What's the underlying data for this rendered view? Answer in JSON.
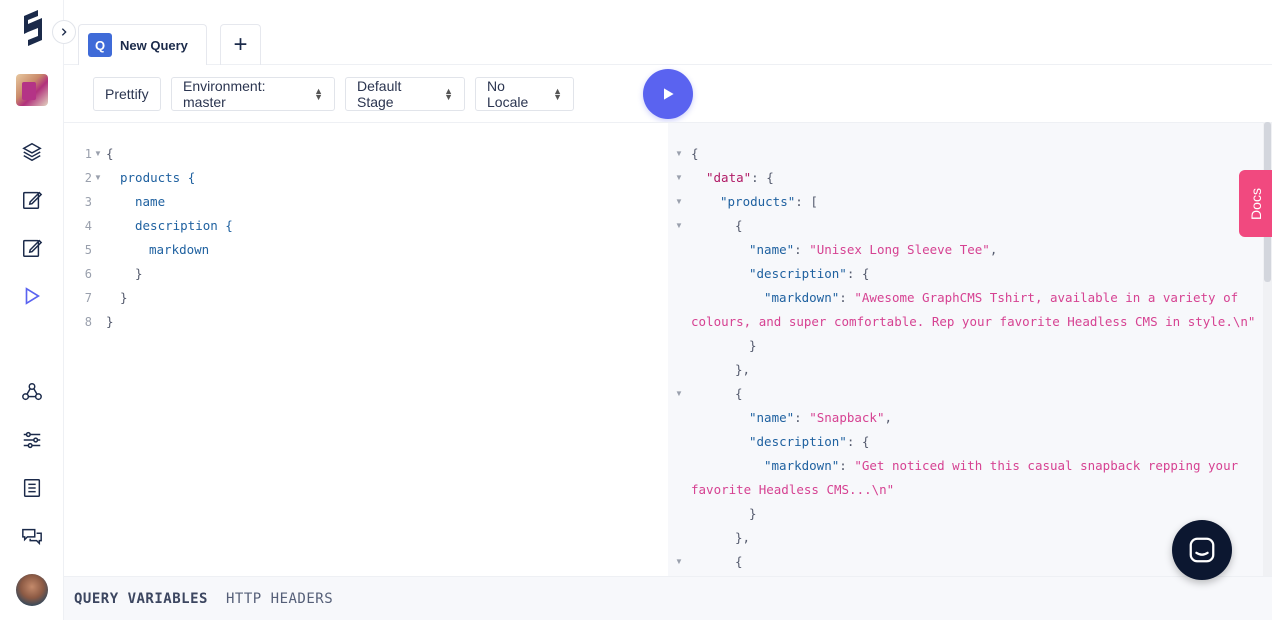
{
  "tab": {
    "badge": "Q",
    "label": "New Query",
    "add_label": "+"
  },
  "toolbar": {
    "prettify_label": "Prettify",
    "environment_label": "Environment: master",
    "stage_label": "Default Stage",
    "locale_label": "No Locale",
    "select_arrows": "▲▼"
  },
  "colors": {
    "accent": "#5a63f0",
    "docs": "#f1497f",
    "badge": "#3f6bd8"
  },
  "query_editor": {
    "lines": [
      {
        "n": "1",
        "text": "{"
      },
      {
        "n": "2",
        "text": "products {"
      },
      {
        "n": "3",
        "text": "name"
      },
      {
        "n": "4",
        "text": "description {"
      },
      {
        "n": "5",
        "text": "markdown"
      },
      {
        "n": "6",
        "text": "}"
      },
      {
        "n": "7",
        "text": "}"
      },
      {
        "n": "8",
        "text": "}"
      }
    ]
  },
  "result": {
    "line1": "{",
    "line2_key": "\"data\"",
    "line2_rest": ": {",
    "line3_key": "\"products\"",
    "line3_rest": ": [",
    "line4": "{",
    "line5_key": "\"name\"",
    "line5_sep": ": ",
    "line5_val": "\"Unisex Long Sleeve Tee\"",
    "line5_end": ",",
    "line6_key": "\"description\"",
    "line6_rest": ": {",
    "line7_key": "\"markdown\"",
    "line7_sep": ": ",
    "line7_val": "\"Awesome GraphCMS Tshirt, available in a variety of",
    "line8_val": "colours, and super comfortable. Rep your favorite Headless CMS in style.\\n\"",
    "line9": "}",
    "line10": "},",
    "line11": "{",
    "line12_key": "\"name\"",
    "line12_sep": ": ",
    "line12_val": "\"Snapback\"",
    "line12_end": ",",
    "line13_key": "\"description\"",
    "line13_rest": ": {",
    "line14_key": "\"markdown\"",
    "line14_sep": ": ",
    "line14_val": "\"Get noticed with this casual snapback repping your",
    "line15_val": "favorite Headless CMS...\\n\"",
    "line16": "}",
    "line17": "},",
    "line18": "{"
  },
  "docs_label": "Docs",
  "bottom": {
    "variables_label": "QUERY VARIABLES",
    "headers_label": "HTTP HEADERS"
  },
  "icons": {
    "logo": "graphcms-logo-icon",
    "collapse": "chevron-right-icon",
    "schema": "layers-icon",
    "content": "edit-icon",
    "content2": "edit-icon",
    "playground": "play-icon",
    "webhooks": "webhook-icon",
    "settings": "sliders-icon",
    "docs": "book-icon",
    "chat": "chat-icon"
  }
}
